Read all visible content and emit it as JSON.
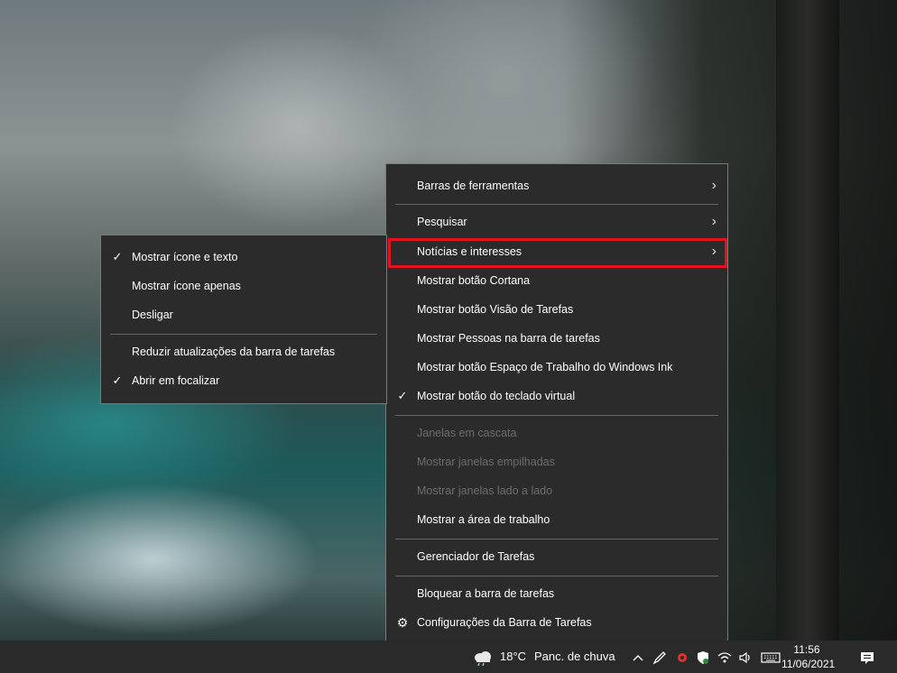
{
  "main_menu": {
    "items": [
      {
        "label": "Barras de ferramentas",
        "submenu": true
      },
      {
        "label": "Pesquisar",
        "submenu": true
      },
      {
        "label": "Notícias e interesses",
        "submenu": true
      },
      {
        "label": "Mostrar botão Cortana"
      },
      {
        "label": "Mostrar botão Visão de Tarefas"
      },
      {
        "label": "Mostrar Pessoas na barra de tarefas"
      },
      {
        "label": "Mostrar botão Espaço de Trabalho do Windows Ink"
      },
      {
        "label": "Mostrar botão do teclado virtual",
        "checked": true
      },
      {
        "label": "Janelas em cascata",
        "disabled": true
      },
      {
        "label": "Mostrar janelas empilhadas",
        "disabled": true
      },
      {
        "label": "Mostrar janelas lado a lado",
        "disabled": true
      },
      {
        "label": "Mostrar a área de trabalho"
      },
      {
        "label": "Gerenciador de Tarefas"
      },
      {
        "label": "Bloquear a barra de tarefas"
      },
      {
        "label": "Configurações da Barra de Tarefas",
        "icon": "gear-icon"
      }
    ]
  },
  "sub_menu": {
    "items": [
      {
        "label": "Mostrar ícone e texto",
        "checked": true
      },
      {
        "label": "Mostrar ícone apenas"
      },
      {
        "label": "Desligar"
      },
      {
        "label": "Reduzir atualizações da barra de tarefas"
      },
      {
        "label": "Abrir em focalizar",
        "checked": true
      }
    ]
  },
  "symbols": {
    "check": "✓",
    "arrow": "›",
    "gear": "⚙"
  },
  "taskbar": {
    "weather_icon": "cloud-rain-icon",
    "temperature": "18°C",
    "weather_text": "Panc. de chuva",
    "tray_icons": [
      "chevron-up-icon",
      "pen-icon",
      "app-icon",
      "security-icon",
      "wifi-icon",
      "volume-icon",
      "keyboard-icon"
    ],
    "time": "11:56",
    "date": "11/06/2021",
    "notification_icon": "notification-icon"
  },
  "colors": {
    "menu_bg": "#2b2b2b",
    "highlight_border": "#e0141e",
    "disabled_text": "#6d6d6d"
  }
}
